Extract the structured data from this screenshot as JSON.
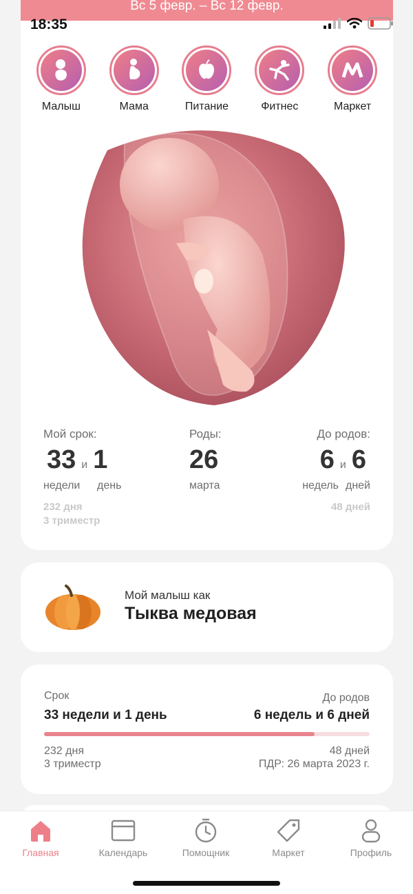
{
  "status": {
    "time": "18:35"
  },
  "header": {
    "week_range": "Вс 5 февр. – Вс 12 февр."
  },
  "menu": [
    {
      "label": "Малыш",
      "icon": "baby-icon"
    },
    {
      "label": "Мама",
      "icon": "pregnant-mother-icon"
    },
    {
      "label": "Питание",
      "icon": "apple-icon"
    },
    {
      "label": "Фитнес",
      "icon": "fitness-icon"
    },
    {
      "label": "Маркет",
      "icon": "market-icon"
    }
  ],
  "term": {
    "label": "Мой срок:",
    "weeks": "33",
    "and": "и",
    "days": "1",
    "weeks_unit": "недели",
    "days_unit": "день",
    "total_days": "232 дня",
    "trimester": "3 триместр"
  },
  "birth": {
    "label": "Роды:",
    "day": "26",
    "month": "марта"
  },
  "until": {
    "label": "До родов:",
    "weeks": "6",
    "and": "и",
    "days": "6",
    "weeks_unit": "недель",
    "days_unit": "дней",
    "total_days": "48 дней"
  },
  "fruit": {
    "caption": "Мой малыш как",
    "name": "Тыква медовая"
  },
  "progress_card": {
    "term_label": "Срок",
    "term_value": "33 недели и 1 день",
    "until_label": "До родов",
    "until_value": "6 недель и 6 дней",
    "progress_fraction": 0.83,
    "days_passed": "232 дня",
    "trimester": "3 триместр",
    "days_left": "48 дней",
    "due_date": "ПДР: 26 марта 2023 г."
  },
  "tabs": [
    {
      "label": "Главная",
      "icon": "home-icon",
      "active": true
    },
    {
      "label": "Календарь",
      "icon": "calendar-icon",
      "active": false
    },
    {
      "label": "Помощник",
      "icon": "stopwatch-icon",
      "active": false
    },
    {
      "label": "Маркет",
      "icon": "tag-icon",
      "active": false
    },
    {
      "label": "Профиль",
      "icon": "profile-icon",
      "active": false
    }
  ],
  "colors": {
    "accent": "#ee7f89",
    "header": "#f08a92",
    "progress_track": "#f8dde0"
  }
}
